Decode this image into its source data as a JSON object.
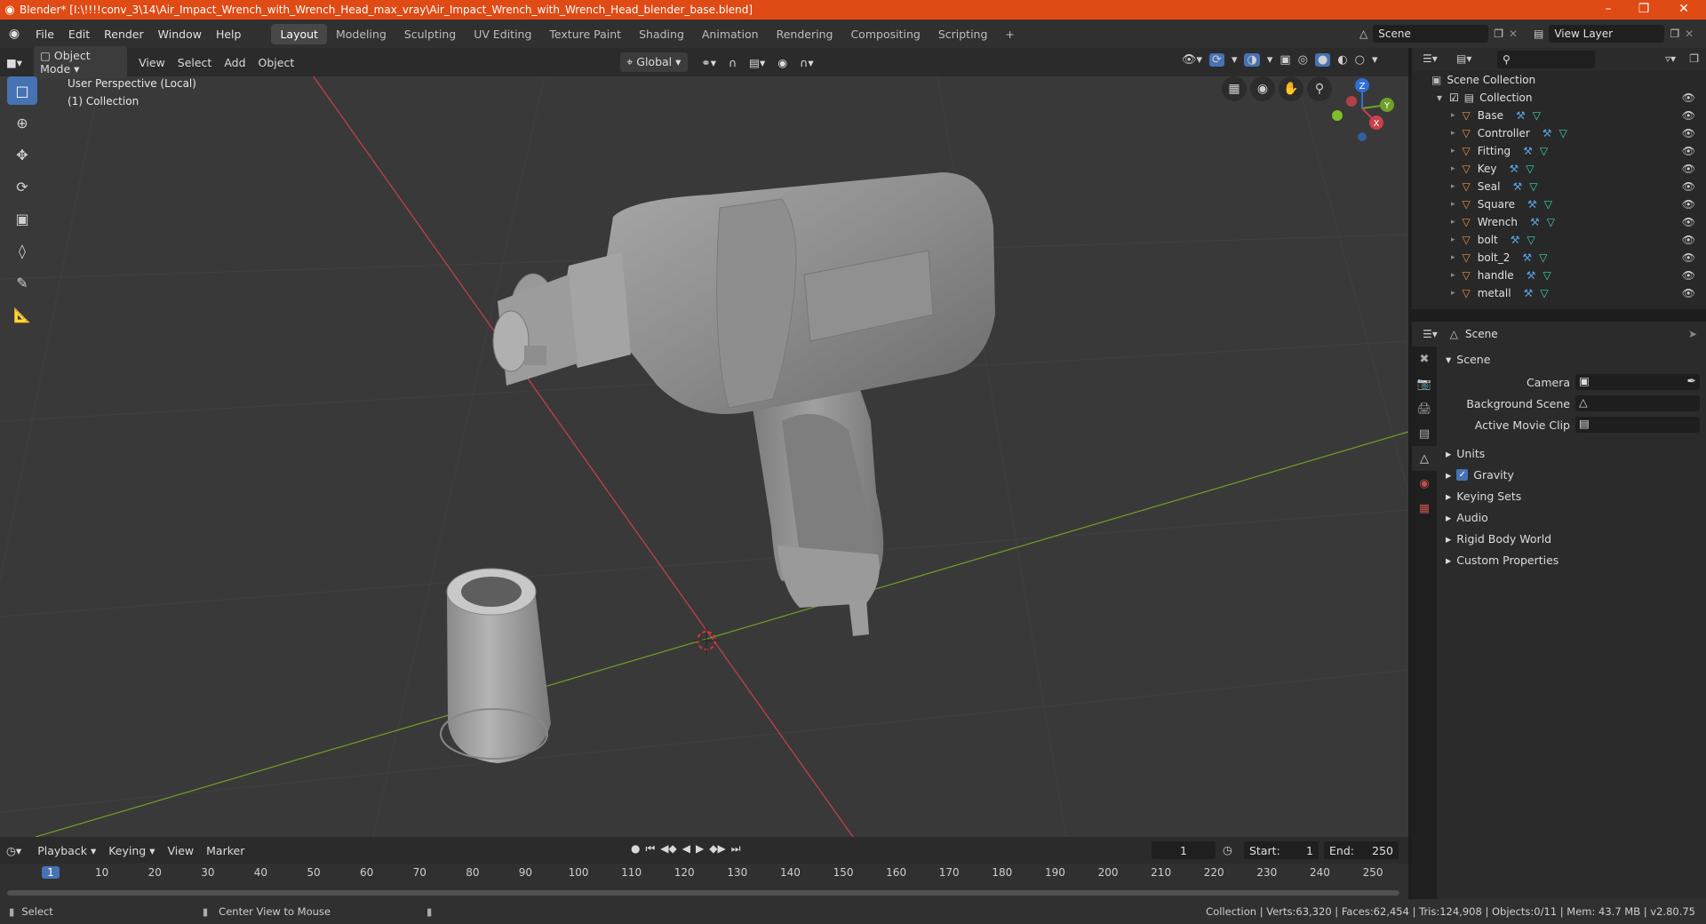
{
  "title": "Blender* [I:\\!!!!conv_3\\14\\Air_Impact_Wrench_with_Wrench_Head_max_vray\\Air_Impact_Wrench_with_Wrench_Head_blender_base.blend]",
  "window_controls": {
    "minimize": "–",
    "maximize": "❐",
    "close": "✕"
  },
  "menu": [
    "File",
    "Edit",
    "Render",
    "Window",
    "Help"
  ],
  "workspaces": [
    "Layout",
    "Modeling",
    "Sculpting",
    "UV Editing",
    "Texture Paint",
    "Shading",
    "Animation",
    "Rendering",
    "Compositing",
    "Scripting"
  ],
  "add_workspace": "+",
  "scene_field": "Scene",
  "view_layer_field": "View Layer",
  "viewport_header": {
    "mode": "Object Mode",
    "menus": [
      "View",
      "Select",
      "Add",
      "Object"
    ],
    "orientation": "Global"
  },
  "viewport_info": {
    "line1": "User Perspective (Local)",
    "line2": "(1) Collection"
  },
  "gizmo": {
    "x": "X",
    "y": "Y",
    "z": "Z"
  },
  "outliner": {
    "root": "Scene Collection",
    "collection": "Collection",
    "objects": [
      "Base",
      "Controller",
      "Fitting",
      "Key",
      "Seal",
      "Square",
      "Wrench",
      "bolt",
      "bolt_2",
      "handle",
      "metall"
    ]
  },
  "properties": {
    "header": "Scene",
    "panel": "Scene",
    "fields": [
      {
        "label": "Camera"
      },
      {
        "label": "Background Scene"
      },
      {
        "label": "Active Movie Clip"
      }
    ],
    "sections": [
      "Units",
      "Gravity",
      "Keying Sets",
      "Audio",
      "Rigid Body World",
      "Custom Properties"
    ]
  },
  "timeline": {
    "menus": [
      "Playback",
      "Keying",
      "View",
      "Marker"
    ],
    "current_frame": "1",
    "start_label": "Start:",
    "start": "1",
    "end_label": "End:",
    "end": "250",
    "ticks": [
      "1",
      "10",
      "20",
      "30",
      "40",
      "50",
      "60",
      "70",
      "80",
      "90",
      "100",
      "110",
      "120",
      "130",
      "140",
      "150",
      "160",
      "170",
      "180",
      "190",
      "200",
      "210",
      "220",
      "230",
      "240",
      "250"
    ]
  },
  "status": {
    "left1": "Select",
    "left2": "Center View to Mouse",
    "right": "Collection | Verts:63,320 | Faces:62,454 | Tris:124,908 | Objects:0/11 | Mem: 43.7 MB | v2.80.75"
  },
  "colors": {
    "title_bar": "#e04a14",
    "active_tool": "#4772b3",
    "x_axis": "#c8414b",
    "y_axis": "#6fa02a",
    "z_axis": "#2f6fd6"
  }
}
